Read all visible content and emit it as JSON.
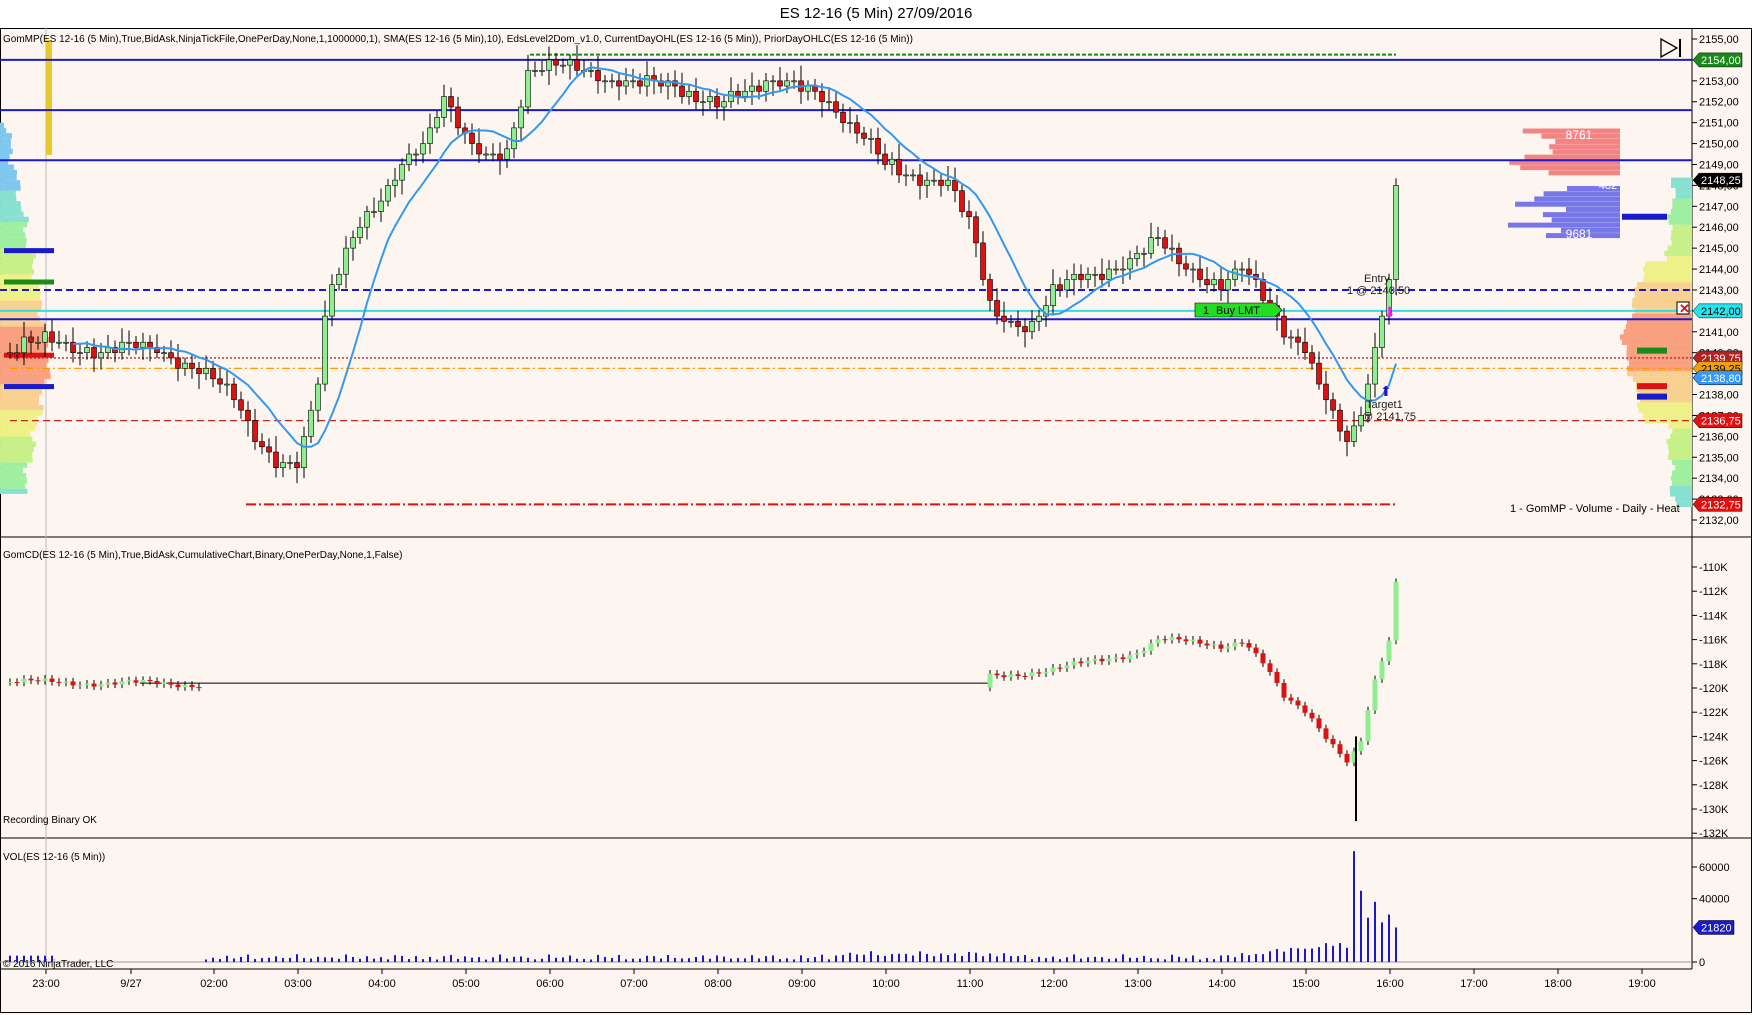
{
  "window": {
    "title": "ES 12-16 (5 Min)  27/09/2016"
  },
  "price_panel": {
    "indicator_label": "GomMP(ES 12-16 (5 Min),True,BidAsk,NinjaTickFile,OnePerDay,None,1,1000000,1), SMA(ES 12-16 (5 Min),10), EdsLevel2Dom_v1.0, CurrentDayOHL(ES 12-16 (5 Min)), PriorDayOHLC(ES 12-16 (5 Min))",
    "profile_label": "1 - GomMP - Volume - Daily - Heat",
    "ticks": [
      "2155,00",
      "2154,00",
      "2153,00",
      "2152,00",
      "2151,00",
      "2150,00",
      "2149,00",
      "2148,00",
      "2147,00",
      "2146,00",
      "2145,00",
      "2144,00",
      "2143,00",
      "2142,00",
      "2141,00",
      "2140,00",
      "2139,00",
      "2138,00",
      "2137,00",
      "2136,00",
      "2135,00",
      "2134,00",
      "2133,00",
      "2132,00"
    ],
    "tags": [
      {
        "label": "2154,00",
        "price": 2154.0,
        "color": "#1a8a1a"
      },
      {
        "label": "2148,25",
        "price": 2148.25,
        "color": "#000000"
      },
      {
        "label": "2142,00",
        "price": 2142.0,
        "color": "#22e5f0",
        "text": "#000"
      },
      {
        "label": "2139,75",
        "price": 2139.75,
        "color": "#b22222"
      },
      {
        "label": "2139,25",
        "price": 2139.25,
        "color": "#f0a000",
        "text": "#000"
      },
      {
        "label": "2138,80",
        "price": 2138.8,
        "color": "#3399ff"
      },
      {
        "label": "2136,75",
        "price": 2136.75,
        "color": "#e01010"
      },
      {
        "label": "2132,75",
        "price": 2132.75,
        "color": "#e01010"
      }
    ],
    "dom": {
      "ask_total": "8761",
      "bid_total": "9681",
      "mid_label": "482"
    },
    "order": {
      "qty": "1",
      "type": "Buy LMT",
      "entry_label": "Entry",
      "entry_detail": "1 @ 2140,50",
      "target_label": "Target1",
      "target_detail": "@ 2141,75"
    }
  },
  "cd_panel": {
    "label": "GomCD(ES 12-16 (5 Min),True,BidAsk,CumulativeChart,Binary,OnePerDay,None,1,False)",
    "status": "Recording Binary OK",
    "ticks": [
      "-110K",
      "-112K",
      "-114K",
      "-116K",
      "-118K",
      "-120K",
      "-122K",
      "-124K",
      "-126K",
      "-128K",
      "-130K",
      "-132K"
    ]
  },
  "vol_panel": {
    "label": "VOL(ES 12-16 (5 Min))",
    "ticks": [
      "60000",
      "40000",
      "0"
    ],
    "last_tag": "21820",
    "copyright": "© 2016 NinjaTrader, LLC"
  },
  "time_axis": [
    "23:00",
    "9/27",
    "02:00",
    "03:00",
    "04:00",
    "05:00",
    "06:00",
    "07:00",
    "08:00",
    "09:00",
    "10:00",
    "11:00",
    "12:00",
    "13:00",
    "14:00",
    "15:00",
    "16:00",
    "17:00",
    "18:00",
    "19:00"
  ],
  "colors": {
    "up": "#90ee90",
    "down": "#dd1111",
    "sma": "#3399ee",
    "level": "#1a1acc",
    "background": "#fdf5ef"
  },
  "chart_data": {
    "type": "candlestick",
    "instrument": "ES 12-16 (5 Min)",
    "price_range": [
      2132,
      2155
    ],
    "price_waypoints_hour": [
      -1.5,
      -1,
      0,
      1.5,
      2,
      2.25,
      2.5,
      2.75,
      3,
      3.25,
      3.35,
      3.75,
      4,
      4.25,
      4.5,
      4.75,
      5,
      5.25,
      5.5,
      5.75,
      6,
      6.5,
      7,
      7.5,
      8,
      8.5,
      9,
      9.25,
      9.5,
      10,
      10.5,
      10.75,
      11,
      11.25,
      11.5,
      11.75,
      12,
      12.5,
      13,
      13.25,
      13.5,
      13.75,
      14,
      14.25,
      14.5,
      14.75,
      15,
      15.25,
      15.4,
      15.5,
      15.65,
      15.8,
      16,
      16.08
    ],
    "price_waypoints": [
      2140,
      2140.5,
      2140.2,
      2139.6,
      2139,
      2137.5,
      2135.5,
      2134.8,
      2135,
      2139,
      2142.5,
      2146,
      2147.5,
      2149.5,
      2150,
      2152,
      2150,
      2149.5,
      2150,
      2153.5,
      2153.5,
      2153.5,
      2153,
      2152.5,
      2152.2,
      2152.5,
      2153,
      2152.5,
      2151,
      2149,
      2148.5,
      2148,
      2146,
      2142,
      2141.5,
      2141.5,
      2143,
      2143.5,
      2145,
      2145.5,
      2144,
      2143.5,
      2143.5,
      2144.5,
      2142.5,
      2140.5,
      2140,
      2138,
      2136.5,
      2136,
      2137,
      2139.5,
      2143.5,
      2148
    ],
    "sma_period": 10,
    "cd_range_k": [
      -132,
      -110
    ],
    "cd_waypoints_hour": [
      -1.5,
      1.5,
      11.25,
      12,
      13,
      13.25,
      14,
      14.25,
      14.5,
      14.75,
      15,
      15.25,
      15.5,
      15.65,
      15.8,
      16,
      16.08
    ],
    "cd_waypoints_k": [
      -119.5,
      -119.7,
      -119,
      -118.5,
      -117,
      -116,
      -116.5,
      -116,
      -118,
      -121,
      -122,
      -124,
      -126,
      -124.5,
      -120,
      -116,
      -111
    ],
    "vol_range": [
      0,
      65000
    ],
    "vol_spikes_hour": [
      15.5,
      15.58,
      15.67,
      15.75,
      15.83,
      15.92,
      16,
      16.08
    ],
    "vol_spikes": [
      9000,
      70000,
      45000,
      28000,
      38000,
      25000,
      30000,
      21820
    ],
    "levels": [
      {
        "price": 2154.0,
        "style": "solid",
        "color": "#1a1acc"
      },
      {
        "price": 2151.6,
        "style": "solid",
        "color": "#1a1acc"
      },
      {
        "price": 2149.2,
        "style": "solid",
        "color": "#1a1acc"
      },
      {
        "price": 2143.0,
        "style": "dashed",
        "color": "#1a1acc"
      },
      {
        "price": 2142.0,
        "style": "solid",
        "color": "#33dddd"
      },
      {
        "price": 2141.6,
        "style": "solid",
        "color": "#1a1acc"
      },
      {
        "price": 2139.75,
        "style": "dotted",
        "color": "#cc2222"
      },
      {
        "price": 2139.25,
        "style": "dashdot",
        "color": "#ff9900"
      },
      {
        "price": 2136.75,
        "style": "dashed",
        "color": "#cc2222"
      }
    ]
  }
}
